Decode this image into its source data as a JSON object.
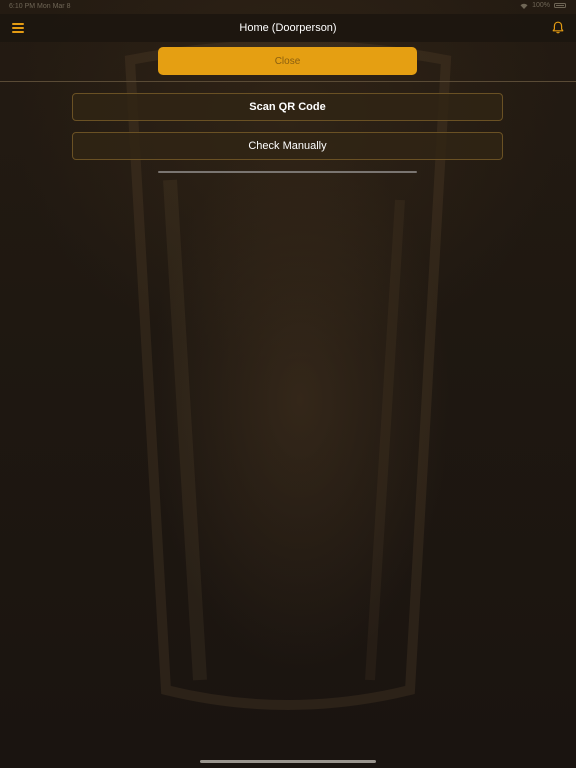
{
  "status_bar": {
    "time": "6:10 PM   Mon Mar 8",
    "battery": "100%"
  },
  "nav": {
    "title": "Home (Doorperson)",
    "menu_icon": "hamburger-menu-icon",
    "notification_icon": "bell-icon"
  },
  "actions": {
    "close_label": "Close",
    "scan_label": "Scan QR Code",
    "manual_label": "Check Manually"
  },
  "colors": {
    "accent": "#e59f12",
    "background": "#1f1811"
  }
}
